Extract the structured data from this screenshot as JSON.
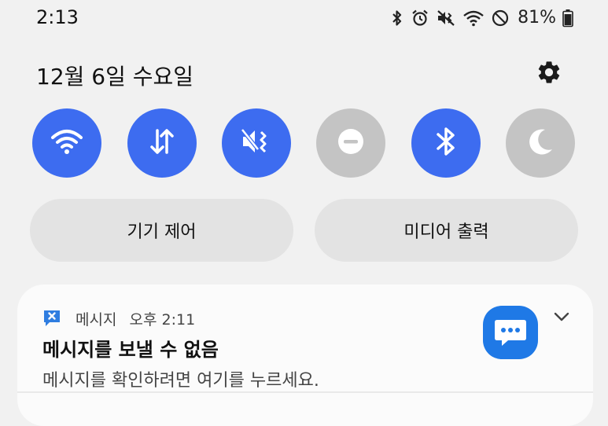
{
  "status_bar": {
    "time": "2:13",
    "battery": "81%",
    "icons": [
      "bluetooth-icon",
      "alarm-icon",
      "vibrate-mute-icon",
      "wifi-icon",
      "do-not-disturb-icon",
      "battery-icon"
    ]
  },
  "panel": {
    "date": "12월 6일 수요일",
    "settings_icon": "gear-icon"
  },
  "toggles": [
    {
      "name": "wifi",
      "icon": "wifi-icon",
      "state": "on"
    },
    {
      "name": "mobile-data",
      "icon": "data-arrows-icon",
      "state": "on"
    },
    {
      "name": "sound-mute",
      "icon": "mute-vibrate-icon",
      "state": "on"
    },
    {
      "name": "do-not-disturb",
      "icon": "minus-circle-icon",
      "state": "off"
    },
    {
      "name": "bluetooth",
      "icon": "bluetooth-icon",
      "state": "on"
    },
    {
      "name": "dark-mode",
      "icon": "moon-icon",
      "state": "off"
    }
  ],
  "buttons": {
    "device_control": "기기 제어",
    "media_output": "미디어 출력"
  },
  "notification": {
    "app_name": "메시지",
    "time": "오후 2:11",
    "title": "메시지를 보낼 수 없음",
    "body": "메시지를 확인하려면 여기를 누르세요."
  },
  "colors": {
    "accent": "#3d6cf0",
    "toggle_off": "#c4c4c4",
    "messages_blue": "#1f79e6",
    "background": "#f1f1f1"
  }
}
